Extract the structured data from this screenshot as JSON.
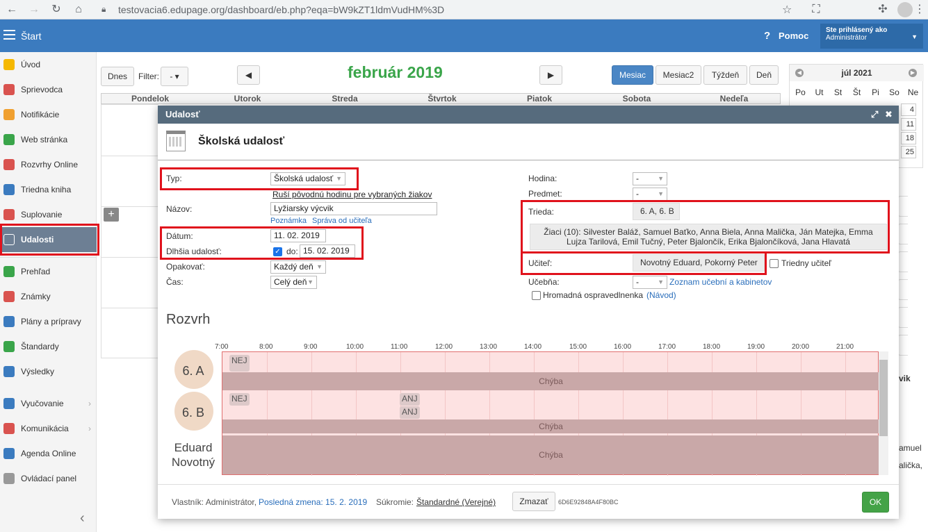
{
  "browser": {
    "url": "testovacia6.edupage.org/dashboard/eb.php?eqa=bW9kZT1ldmVudHM%3D"
  },
  "header": {
    "start_label": "Štart",
    "help_label": "Pomoc",
    "user_line1": "Ste prihlásený ako",
    "user_line2": "Administrátor"
  },
  "sidebar": {
    "items": [
      {
        "label": "Úvod",
        "color": "#f5b800"
      },
      {
        "label": "Sprievodca",
        "color": "#d9534f"
      },
      {
        "label": "Notifikácie",
        "color": "#f0a030"
      },
      {
        "label": "Web stránka",
        "color": "#3aa54a"
      },
      {
        "label": "Rozvrhy Online",
        "color": "#d9534f"
      },
      {
        "label": "Triedna kniha",
        "color": "#3b7bbf"
      },
      {
        "label": "Suplovanie",
        "color": "#d9534f"
      },
      {
        "label": "Udalosti",
        "color": "#ffffff"
      },
      {
        "label": "Prehľad",
        "color": "#3aa54a"
      },
      {
        "label": "Známky",
        "color": "#d9534f"
      },
      {
        "label": "Plány a prípravy",
        "color": "#3b7bbf"
      },
      {
        "label": "Štandardy",
        "color": "#3aa54a"
      },
      {
        "label": "Výsledky",
        "color": "#3b7bbf"
      },
      {
        "label": "Vyučovanie",
        "color": "#3b7bbf"
      },
      {
        "label": "Komunikácia",
        "color": "#d9534f"
      },
      {
        "label": "Agenda Online",
        "color": "#3b7bbf"
      },
      {
        "label": "Ovládací panel",
        "color": "#999999"
      }
    ]
  },
  "calendar": {
    "today_label": "Dnes",
    "filter_label": "Filter:",
    "filter_value": "- ▾",
    "month_title": "február 2019",
    "views": [
      "Mesiac",
      "Mesiac2",
      "Týždeň",
      "Deň"
    ],
    "days": [
      "Pondelok",
      "Utorok",
      "Streda",
      "Štvrtok",
      "Piatok",
      "Sobota",
      "Nedeľa"
    ],
    "plus": "+"
  },
  "mini_calendar": {
    "title": "júl 2021",
    "day_names": [
      "Po",
      "Ut",
      "St",
      "Št",
      "Pi",
      "So",
      "Ne"
    ],
    "visible_days": [
      "4",
      "11",
      "18",
      "25"
    ]
  },
  "right_partial": {
    "text1": "vik",
    "text2": "amuel",
    "text3": "alička,"
  },
  "modal": {
    "title": "Udalosť",
    "heading": "Školská udalosť",
    "left": {
      "typ_label": "Typ:",
      "typ_value": "Školská udalosť",
      "rusi_link": "Ruší pôvodnú hodinu pre vybraných žiakov",
      "nazov_label": "Názov:",
      "nazov_value": "Lyžiarsky výcvik",
      "poznamka_link": "Poznámka",
      "sprava_link": "Správa od učiteľa",
      "datum_label": "Dátum:",
      "datum_value": "11. 02. 2019",
      "dlhsia_label": "Dlhšia udalosť:",
      "do_label": "do:",
      "do_value": "15. 02. 2019",
      "opakovat_label": "Opakovať:",
      "opakovat_value": "Každý deň",
      "cas_label": "Čas:",
      "cas_value": "Celý deň"
    },
    "right": {
      "hodina_label": "Hodina:",
      "hodina_value": "-",
      "predmet_label": "Predmet:",
      "predmet_value": "-",
      "trieda_label": "Trieda:",
      "trieda_value": "6. A, 6. B",
      "ziaci_text": "Žiaci (10): Silvester Baláž, Samuel Baťko, Anna Biela, Anna Malička, Ján Matejka, Emma Lujza Tarilová, Emil Tučný, Peter Bjalončík, Erika Bjalončíková, Jana Hlavatá",
      "ucitel_label": "Učiteľ:",
      "ucitel_value": "Novotný Eduard, Pokorný Peter",
      "triedny_label": "Triedny učiteľ",
      "ucebna_label": "Učebňa:",
      "ucebna_value": "-",
      "zoznam_link": "Zoznam učební a kabinetov",
      "hromadna_label": "Hromadná ospravedlnenka",
      "navod_link": "(Návod)"
    },
    "schedule": {
      "title": "Rozvrh",
      "hours": [
        "7:00",
        "8:00",
        "9:00",
        "10:00",
        "11:00",
        "12:00",
        "13:00",
        "14:00",
        "15:00",
        "16:00",
        "17:00",
        "18:00",
        "19:00",
        "20:00",
        "21:00"
      ],
      "rows": [
        {
          "name": "6. A",
          "band": "Chýba"
        },
        {
          "name": "6. B",
          "band": "Chýba"
        },
        {
          "name": "Eduard Novotný",
          "band": "Chýba"
        }
      ],
      "lesson_nej": "NEJ",
      "lesson_anj": "ANJ"
    },
    "footer": {
      "owner": "Vlastník: Administrátor,",
      "last_change": "Posledná zmena: 15. 2. 2019",
      "privacy_label": "Súkromie:",
      "privacy_value": "Štandardné (Verejné)",
      "delete_label": "Zmazať",
      "event_id": "6D6E92848A4F80BC",
      "ok_label": "OK"
    }
  }
}
